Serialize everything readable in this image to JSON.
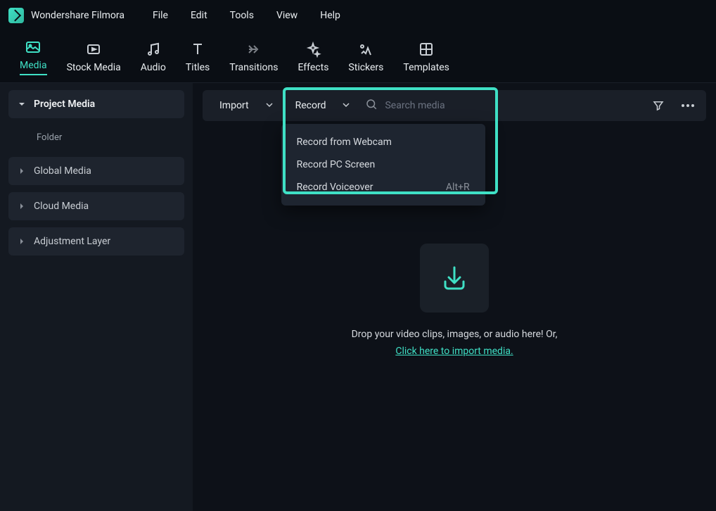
{
  "app": {
    "title": "Wondershare Filmora"
  },
  "menubar": {
    "items": [
      "File",
      "Edit",
      "Tools",
      "View",
      "Help"
    ]
  },
  "tabs": [
    {
      "label": "Media",
      "active": true
    },
    {
      "label": "Stock Media",
      "active": false
    },
    {
      "label": "Audio",
      "active": false
    },
    {
      "label": "Titles",
      "active": false
    },
    {
      "label": "Transitions",
      "active": false
    },
    {
      "label": "Effects",
      "active": false
    },
    {
      "label": "Stickers",
      "active": false
    },
    {
      "label": "Templates",
      "active": false
    }
  ],
  "sidebar": {
    "items": [
      {
        "label": "Project Media",
        "expanded": true
      },
      {
        "label": "Global Media",
        "expanded": false
      },
      {
        "label": "Cloud Media",
        "expanded": false
      },
      {
        "label": "Adjustment Layer",
        "expanded": false
      }
    ],
    "folder_label": "Folder"
  },
  "toolbar": {
    "import_label": "Import",
    "record_label": "Record",
    "search_placeholder": "Search media"
  },
  "record_menu": {
    "items": [
      {
        "label": "Record from Webcam",
        "shortcut": ""
      },
      {
        "label": "Record PC Screen",
        "shortcut": ""
      },
      {
        "label": "Record Voiceover",
        "shortcut": "Alt+R"
      }
    ]
  },
  "dropzone": {
    "text": "Drop your video clips, images, or audio here! Or,",
    "link": "Click here to import media."
  }
}
